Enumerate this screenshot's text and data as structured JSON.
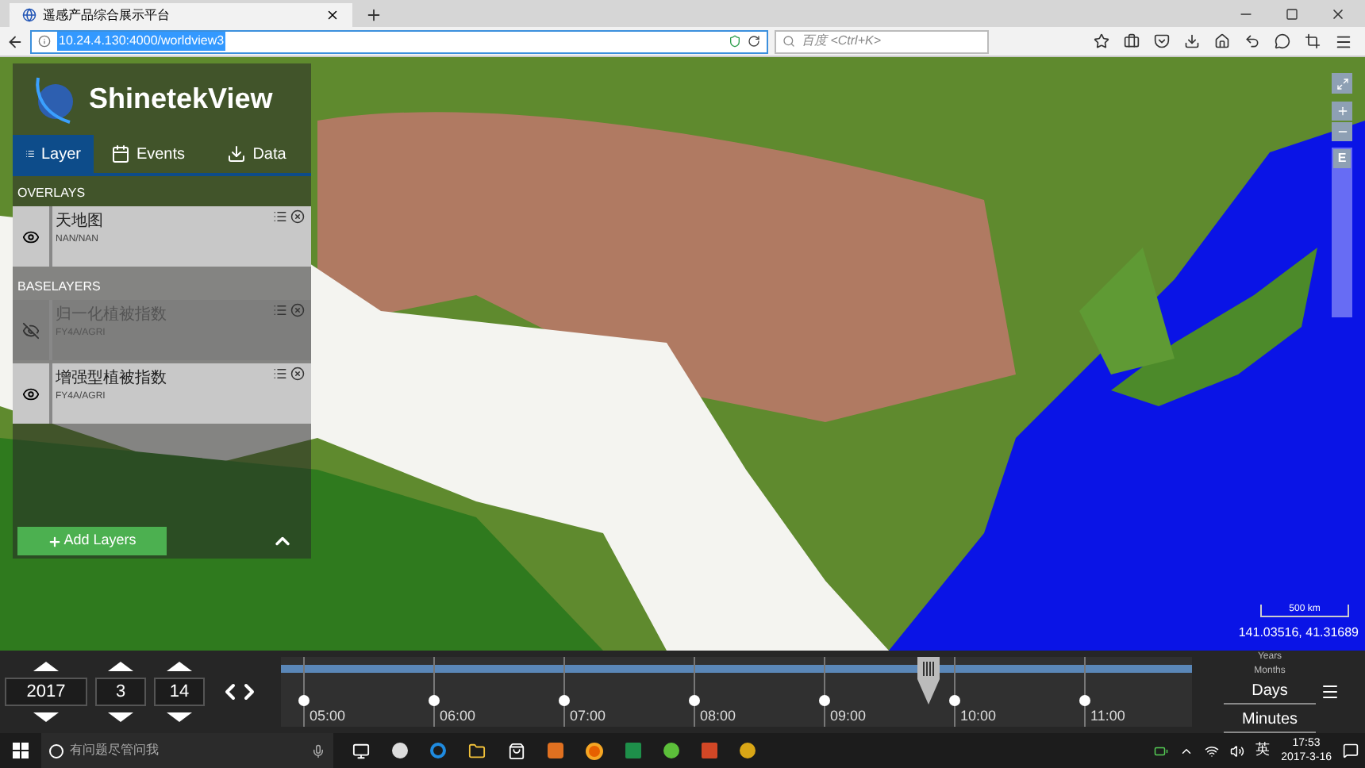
{
  "browser": {
    "tab_title": "遥感产品综合展示平台",
    "url": "10.24.4.130:4000/worldview3",
    "search_placeholder": "百度 <Ctrl+K>"
  },
  "panel": {
    "app_name": "ShinetekView",
    "tabs": [
      {
        "kind": "layer",
        "label": "Layer",
        "selected": true
      },
      {
        "kind": "events",
        "label": "Events",
        "selected": false
      },
      {
        "kind": "data",
        "label": "Data",
        "selected": false
      }
    ],
    "sections": [
      {
        "heading": "OVERLAYS",
        "layers": [
          {
            "name": "天地图",
            "source": "NAN/NAN",
            "visible": true
          }
        ]
      },
      {
        "heading": "BASELAYERS",
        "layers": [
          {
            "name": "归一化植被指数",
            "source": "FY4A/AGRI",
            "visible": false
          },
          {
            "name": "增强型植被指数",
            "source": "FY4A/AGRI",
            "visible": true
          }
        ]
      }
    ],
    "add_button": "Add Layers"
  },
  "map": {
    "projection_button": "E",
    "scale_label": "500 km",
    "coordinates": "141.03516, 41.31689"
  },
  "timeline": {
    "date_fields": [
      "2017",
      "3",
      "14"
    ],
    "ticks": [
      "05:00",
      "06:00",
      "07:00",
      "08:00",
      "09:00",
      "10:00",
      "11:00"
    ],
    "level": 0.71,
    "zoom_levels": [
      {
        "label": "Years",
        "selected": false
      },
      {
        "label": "Months",
        "selected": false
      },
      {
        "label": "Days",
        "selected": true
      }
    ],
    "interval": "Minutes"
  },
  "taskbar": {
    "search_placeholder": "有问题尽管问我",
    "input_language": "英",
    "time": "17:53",
    "date": "2017-3-16"
  }
}
